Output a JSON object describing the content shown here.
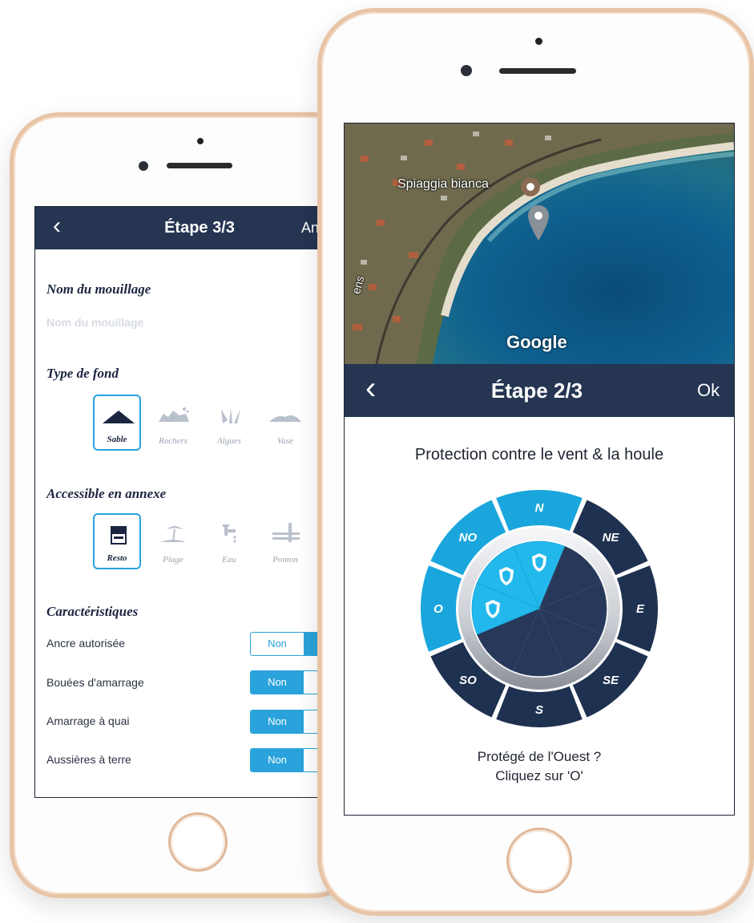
{
  "back_screen": {
    "header": {
      "back_icon": "chevron-left-icon",
      "title": "Étape 3/3",
      "right_label": "An"
    },
    "name_section": {
      "title": "Nom du mouillage",
      "placeholder": "Nom du mouillage"
    },
    "bottom_section": {
      "title": "Type de fond",
      "options": [
        {
          "label": "Sable",
          "icon": "sand-icon",
          "selected": true
        },
        {
          "label": "Rochers",
          "icon": "rocks-icon",
          "selected": false
        },
        {
          "label": "Algues",
          "icon": "seaweed-icon",
          "selected": false
        },
        {
          "label": "Vase",
          "icon": "mud-icon",
          "selected": false
        }
      ]
    },
    "annex_section": {
      "title": "Accessible en annexe",
      "options": [
        {
          "label": "Resto",
          "icon": "restaurant-icon",
          "selected": true
        },
        {
          "label": "Plage",
          "icon": "beach-icon",
          "selected": false
        },
        {
          "label": "Eau",
          "icon": "water-tap-icon",
          "selected": false
        },
        {
          "label": "Ponton",
          "icon": "pontoon-icon",
          "selected": false
        }
      ]
    },
    "features_section": {
      "title": "Caractéristiques",
      "rows": [
        {
          "label": "Ancre autorisée",
          "toggle_label": "Non",
          "non_active": false
        },
        {
          "label": "Bouées d'amarrage",
          "toggle_label": "Non",
          "non_active": true
        },
        {
          "label": "Amarrage à quai",
          "toggle_label": "Non",
          "non_active": true
        },
        {
          "label": "Aussières à terre",
          "toggle_label": "Non",
          "non_active": true
        }
      ]
    }
  },
  "front_screen": {
    "map": {
      "place_label": "Spiaggia bianca",
      "street_label": "ens",
      "provider": "Google"
    },
    "header": {
      "back_icon": "chevron-left-icon",
      "title": "Étape 2/3",
      "ok_label": "Ok"
    },
    "instruction": "Protection contre le vent & la houle",
    "compass": {
      "directions": [
        "N",
        "NE",
        "E",
        "SE",
        "S",
        "SO",
        "O",
        "NO"
      ],
      "protected": [
        "N",
        "O",
        "NO"
      ]
    },
    "hint_line1": "Protégé de l'Ouest ?",
    "hint_line2": "Cliquez sur 'O'"
  },
  "colors": {
    "navbar": "#253552",
    "accent": "#2aa3dc",
    "rose_active": "#1aa6dd",
    "rose_active_inner": "#22b8ec",
    "rose_inactive": "#1f3150",
    "rose_inactive_inner": "#27385a",
    "phone_frame": "#e8c4a6"
  }
}
